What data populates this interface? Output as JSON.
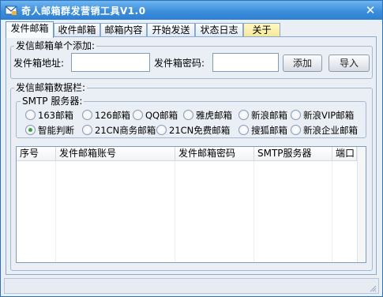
{
  "window": {
    "title": "奇人邮箱群发营销工具V1.0",
    "close_symbol": "✕"
  },
  "tabs": [
    {
      "label": "发件邮箱",
      "active": true
    },
    {
      "label": "收件邮箱"
    },
    {
      "label": "邮箱内容"
    },
    {
      "label": "开始发送"
    },
    {
      "label": "状态日志"
    },
    {
      "label": "关于"
    }
  ],
  "single_add": {
    "legend": "发信邮箱单个添加:",
    "address_label": "发件箱地址:",
    "address_value": "",
    "password_label": "发件箱密码:",
    "password_value": "",
    "add_button": "添加",
    "import_button": "导入"
  },
  "data_section": {
    "legend": "发信邮箱数据栏:",
    "smtp_legend": "SMTP 服务器:",
    "radios": [
      {
        "label": "163邮箱",
        "checked": false
      },
      {
        "label": "126邮箱",
        "checked": false
      },
      {
        "label": "QQ邮箱",
        "checked": false
      },
      {
        "label": "雅虎邮箱",
        "checked": false
      },
      {
        "label": "新浪邮箱",
        "checked": false
      },
      {
        "label": "新浪VIP邮箱",
        "checked": false
      },
      {
        "label": "智能判断",
        "checked": true
      },
      {
        "label": "21CN商务邮箱",
        "checked": false
      },
      {
        "label": "21CN免费邮箱",
        "checked": false
      },
      {
        "label": "搜狐邮箱",
        "checked": false
      },
      {
        "label": "新浪企业邮箱",
        "checked": false
      }
    ]
  },
  "table": {
    "columns": [
      "序号",
      "发件邮箱账号",
      "发件邮箱密码",
      "SMTP服务器",
      "端口"
    ],
    "rows": []
  },
  "statusbar": {
    "text": ""
  }
}
